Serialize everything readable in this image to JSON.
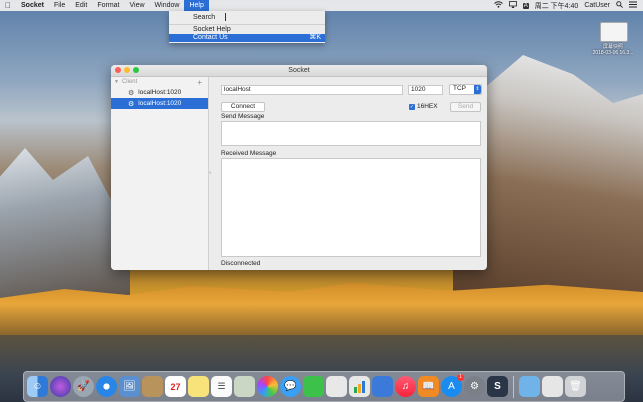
{
  "menubar": {
    "apple": "",
    "app_name": "Socket",
    "menus": [
      "File",
      "Edit",
      "Format",
      "View",
      "Window",
      "Help"
    ],
    "status": {
      "input_method": "A",
      "clock": "周二 下午4:40",
      "user": "CatUser"
    }
  },
  "help_menu": {
    "search_label": "Search",
    "items": [
      {
        "label": "Socket Help",
        "shortcut": ""
      },
      {
        "label": "Contact Us",
        "shortcut": "⌘K"
      }
    ]
  },
  "desktop": {
    "icon_label_line1": "屏幕快照",
    "icon_label_line2": "2018-03-06 16.3..."
  },
  "window": {
    "title": "Socket",
    "sidebar": {
      "section": "Client",
      "add": "+",
      "items": [
        {
          "label": "localHost:1020",
          "selected": false
        },
        {
          "label": "localHost:1020",
          "selected": true
        }
      ]
    },
    "host_value": "localHost",
    "port_value": "1020",
    "protocol": "TCP",
    "connect_label": "Connect",
    "hex_label": "16HEX",
    "hex_checked": true,
    "send_label": "Send",
    "send_message_label": "Send Message",
    "received_message_label": "Received Message",
    "status": "Disconnected"
  },
  "dock": {
    "appstore_badge": "1",
    "calendar_day": "27",
    "socket_app_letter": "S"
  },
  "colors": {
    "accent": "#2b6fd6"
  }
}
